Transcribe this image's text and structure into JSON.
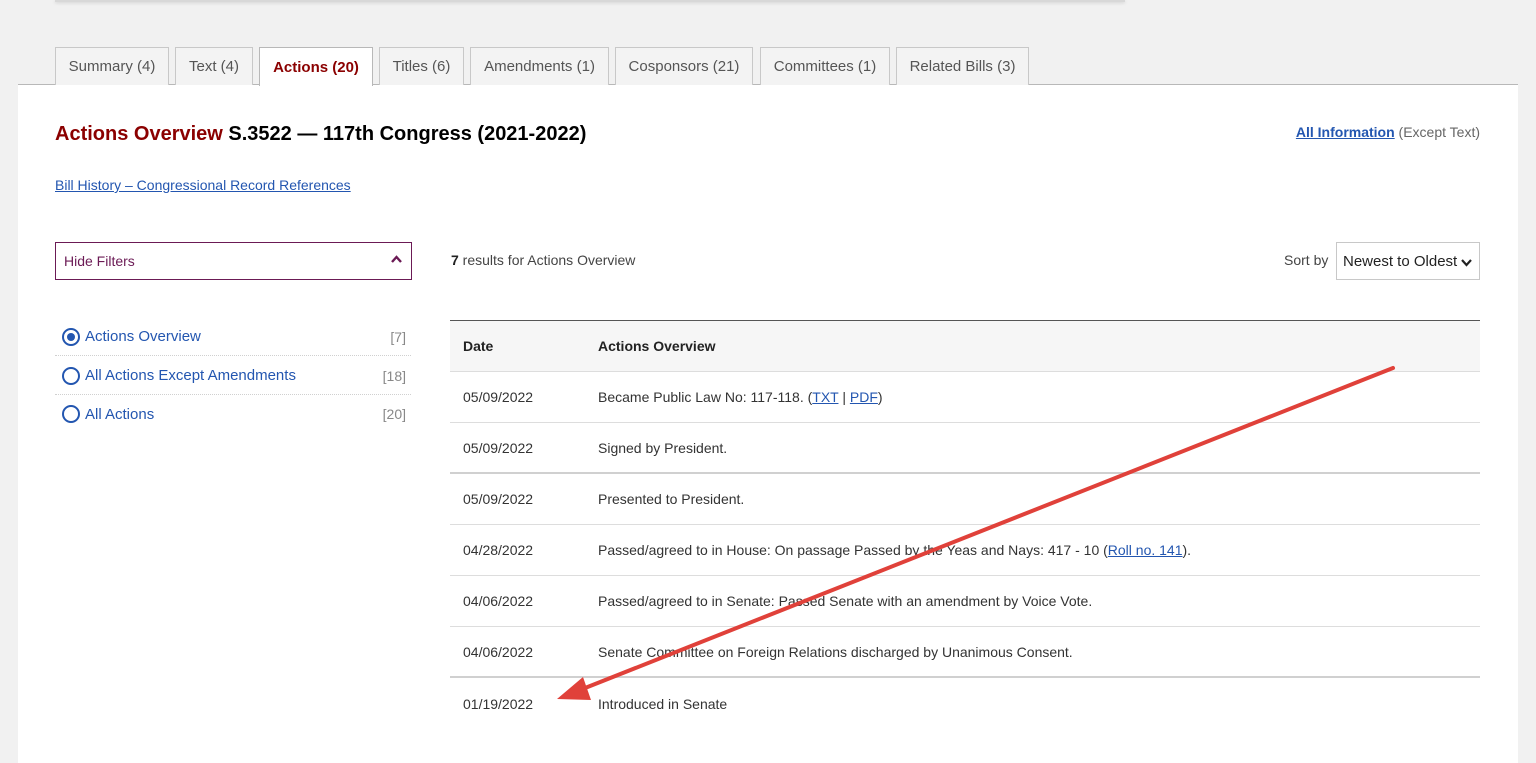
{
  "tabs": [
    {
      "label": "Summary (4)"
    },
    {
      "label": "Text (4)"
    },
    {
      "label": "Actions (20)"
    },
    {
      "label": "Titles (6)"
    },
    {
      "label": "Amendments (1)"
    },
    {
      "label": "Cosponsors (21)"
    },
    {
      "label": "Committees (1)"
    },
    {
      "label": "Related Bills (3)"
    }
  ],
  "header": {
    "title_prefix": "Actions Overview",
    "title_rest": " S.3522 — 117th Congress (2021-2022)",
    "all_info_link": "All Information",
    "all_info_suffix": " (Except Text)",
    "history_link": "Bill History – Congressional Record References"
  },
  "filters": {
    "toggle_label": "Hide Filters",
    "items": [
      {
        "label": "Actions Overview",
        "count": "[7]"
      },
      {
        "label": "All Actions Except Amendments",
        "count": "[18]"
      },
      {
        "label": "All Actions",
        "count": "[20]"
      }
    ]
  },
  "results": {
    "count": "7",
    "text": " results for Actions Overview",
    "sort_label": "Sort by",
    "sort_value": "Newest to Oldest"
  },
  "table": {
    "col_date": "Date",
    "col_action": "Actions Overview",
    "rows": [
      {
        "date": "05/09/2022",
        "pre": "Became Public Law No: 117-118. (",
        "link1": "TXT",
        "mid": " | ",
        "link2": "PDF",
        "post": ")"
      },
      {
        "date": "05/09/2022",
        "text": "Signed by President."
      },
      {
        "date": "05/09/2022",
        "text": "Presented to President."
      },
      {
        "date": "04/28/2022",
        "pre": "Passed/agreed to in House: On passage Passed by the Yeas and Nays: 417 - 10 (",
        "link1": "Roll no. 141",
        "post": ")."
      },
      {
        "date": "04/06/2022",
        "text": "Passed/agreed to in Senate: Passed Senate with an amendment by Voice Vote."
      },
      {
        "date": "04/06/2022",
        "text": "Senate Committee on Foreign Relations discharged by Unanimous Consent."
      },
      {
        "date": "01/19/2022",
        "text": "Introduced in Senate"
      }
    ]
  },
  "colors": {
    "accent_red": "#8b0000",
    "link_blue": "#2356b0",
    "filter_purple": "#6b1a55",
    "annotation_arrow": "#e0413a"
  }
}
